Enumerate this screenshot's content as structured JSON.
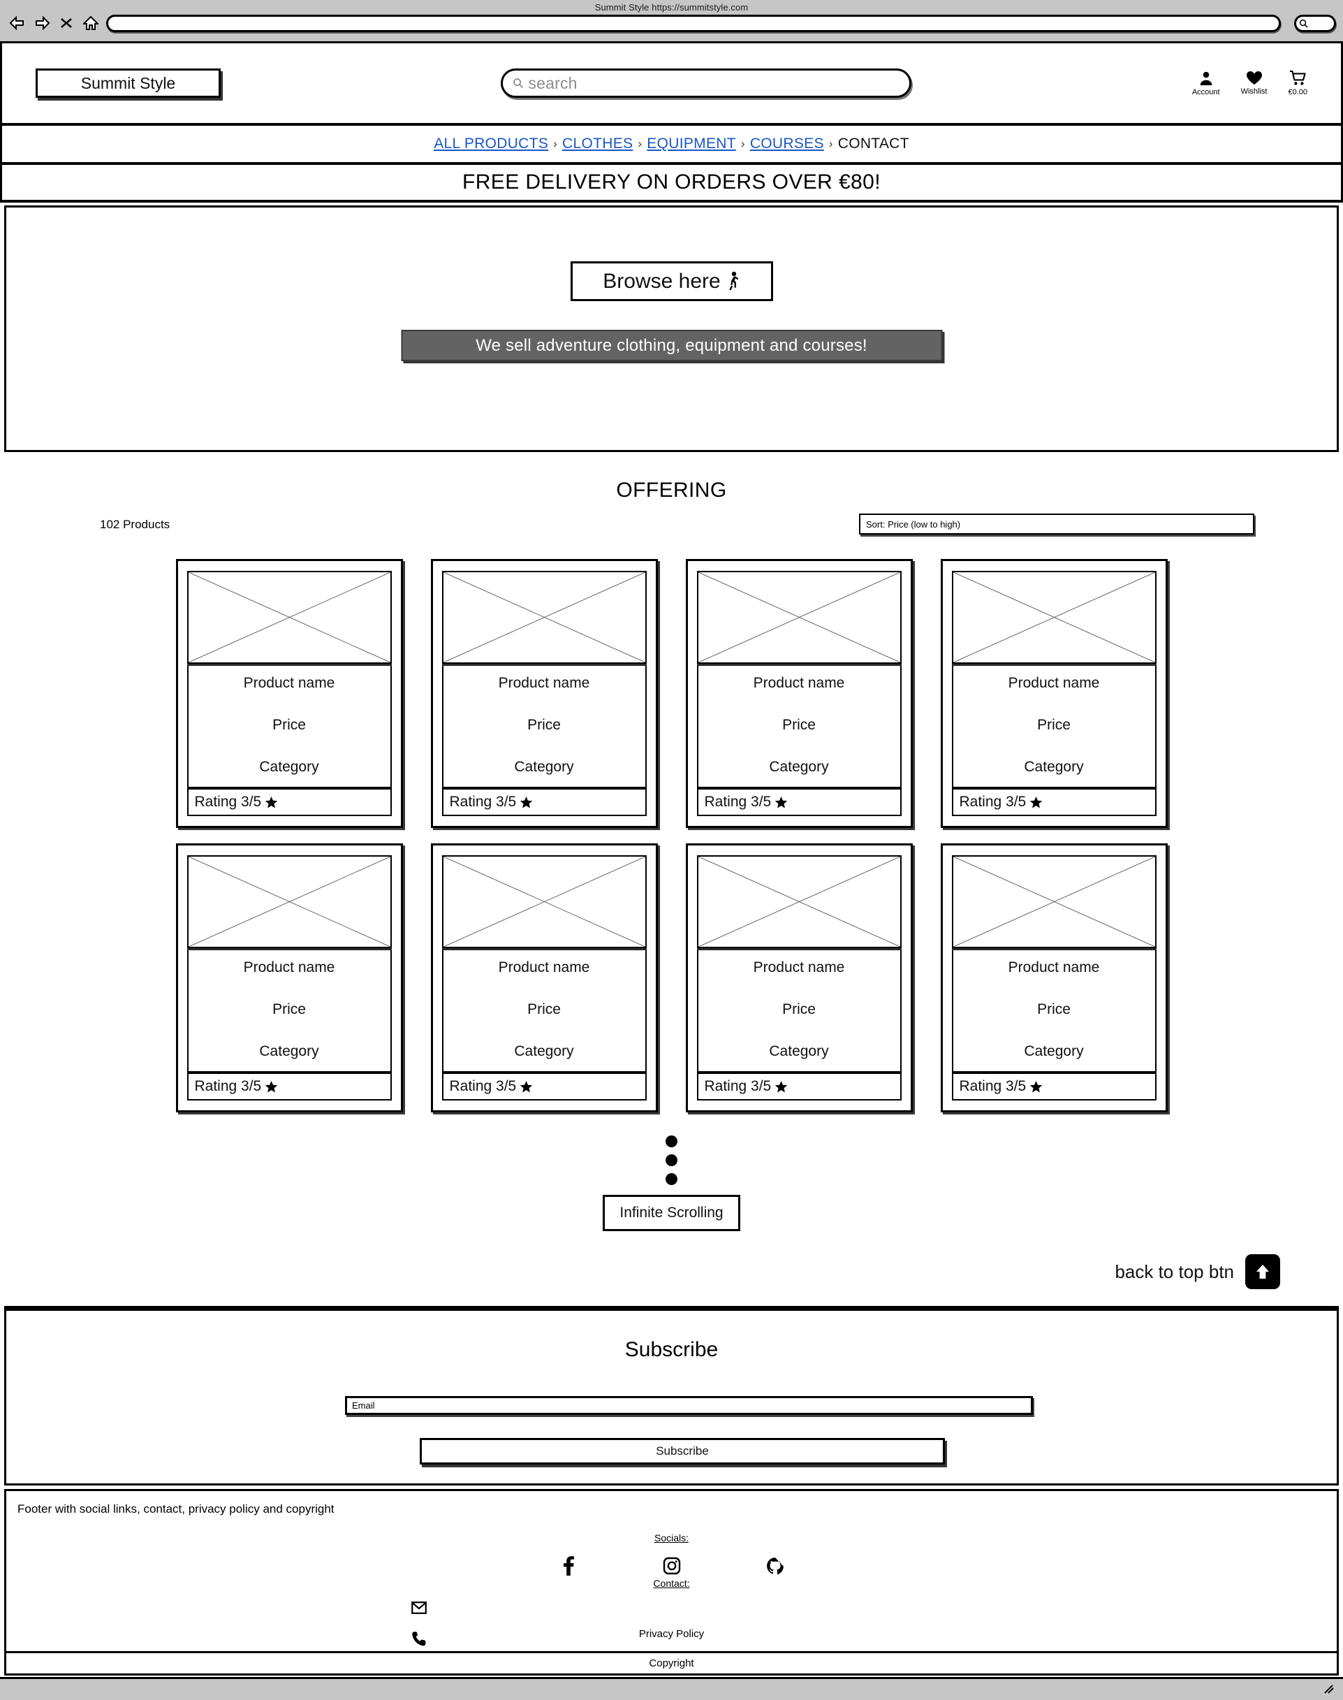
{
  "browser": {
    "title": "Summit Style https://summitstyle.com",
    "url_value": "",
    "nav_icons": [
      "back-icon",
      "forward-icon",
      "stop-icon",
      "home-icon"
    ],
    "chrome_search_icon": "search-icon"
  },
  "header": {
    "logo": "Summit Style",
    "search_placeholder": "search",
    "icons": [
      {
        "name": "account-icon",
        "label": "Account"
      },
      {
        "name": "wishlist-heart-icon",
        "label": "Wishlist"
      },
      {
        "name": "cart-icon",
        "label": "€0.00"
      }
    ]
  },
  "nav": {
    "separator": "›",
    "items": [
      {
        "label": "ALL PRODUCTS",
        "link": true
      },
      {
        "label": "CLOTHES",
        "link": true
      },
      {
        "label": "EQUIPMENT",
        "link": true
      },
      {
        "label": "COURSES",
        "link": true
      },
      {
        "label": "CONTACT",
        "link": false
      }
    ],
    "link_color": "#1a56c4"
  },
  "promo": {
    "text": "FREE DELIVERY ON ORDERS OVER €80!"
  },
  "hero": {
    "browse_label": "Browse here",
    "browse_icon": "walking-person-icon",
    "banner_text": "We sell adventure clothing, equipment and courses!",
    "banner_bg": "#636363"
  },
  "offering": {
    "title": "OFFERING",
    "product_count": "102 Products",
    "sort_value": "Sort: Price (low to high)"
  },
  "products": [
    {
      "name": "Product name",
      "price": "Price",
      "category": "Category",
      "rating": "Rating 3/5"
    },
    {
      "name": "Product name",
      "price": "Price",
      "category": "Category",
      "rating": "Rating 3/5"
    },
    {
      "name": "Product name",
      "price": "Price",
      "category": "Category",
      "rating": "Rating 3/5"
    },
    {
      "name": "Product name",
      "price": "Price",
      "category": "Category",
      "rating": "Rating 3/5"
    },
    {
      "name": "Product name",
      "price": "Price",
      "category": "Category",
      "rating": "Rating 3/5"
    },
    {
      "name": "Product name",
      "price": "Price",
      "category": "Category",
      "rating": "Rating 3/5"
    },
    {
      "name": "Product name",
      "price": "Price",
      "category": "Category",
      "rating": "Rating 3/5"
    },
    {
      "name": "Product name",
      "price": "Price",
      "category": "Category",
      "rating": "Rating 3/5"
    }
  ],
  "infinite": {
    "label": "Infinite Scrolling"
  },
  "back_to_top": {
    "label": "back to top btn",
    "icon": "arrow-up-icon"
  },
  "subscribe": {
    "title": "Subscribe",
    "email_placeholder": "Email",
    "button_label": "Subscribe"
  },
  "footer": {
    "note": "Footer with social links, contact, privacy policy and copyright",
    "socials_label": "Socials:",
    "contact_label": "Contact:",
    "social_icons": [
      "facebook-icon",
      "instagram-icon",
      "github-icon"
    ],
    "contact_icons": [
      "email-icon",
      "phone-icon"
    ],
    "privacy_policy": "Privacy Policy",
    "copyright": "Copyright"
  }
}
